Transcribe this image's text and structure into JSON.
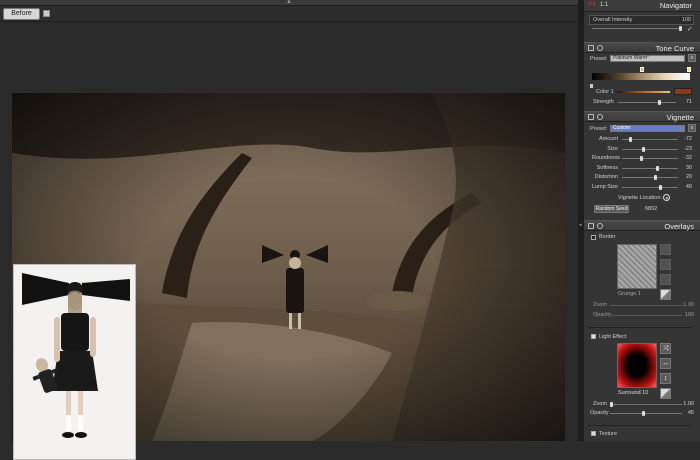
{
  "toolbar": {
    "before_label": "Before"
  },
  "navigator": {
    "fit_label": "Fit",
    "ratio_label": "1:1",
    "title": "Navigator",
    "overall_intensity_label": "Overall Intensity",
    "overall_intensity_value": "100",
    "overall_intensity_level": 1.0
  },
  "tone_curve": {
    "title": "Tone Curve",
    "preset_label": "Preset:",
    "preset_value": "Platinum Warm*",
    "color_label": "Color 1",
    "strength_label": "Strength",
    "strength_value": "71",
    "strength_level": 0.71
  },
  "vignette": {
    "title": "Vignette",
    "preset_label": "Preset:",
    "preset_value": "Custom",
    "rows": [
      {
        "label": "Amount",
        "value": "-72",
        "level": 0.14
      },
      {
        "label": "Size",
        "value": "-23",
        "level": 0.385
      },
      {
        "label": "Roundness",
        "value": "-32",
        "level": 0.34
      },
      {
        "label": "Softness",
        "value": "30",
        "level": 0.65
      },
      {
        "label": "Distortion",
        "value": "20",
        "level": 0.6
      },
      {
        "label": "Lump Size",
        "value": "40",
        "level": 0.7
      }
    ],
    "location_label": "Vignette Location:",
    "random_seed_label": "Random Seed",
    "random_seed_value": "6802"
  },
  "overlays": {
    "title": "Overlays",
    "border_label": "Border",
    "grunge_value": "Grunge 1",
    "zoom_label": "Zoom",
    "zoom_value": "1.00",
    "opacity_label": "Opacity",
    "opacity_value": "100",
    "light_effect_label": "Light Effect",
    "surround_value": "Surround 10",
    "le_zoom_label": "Zoom",
    "le_zoom_value": "1.00",
    "le_opacity_label": "Opacity",
    "le_opacity_value": "45",
    "le_opacity_level": 0.45,
    "texture_label": "Texture"
  }
}
